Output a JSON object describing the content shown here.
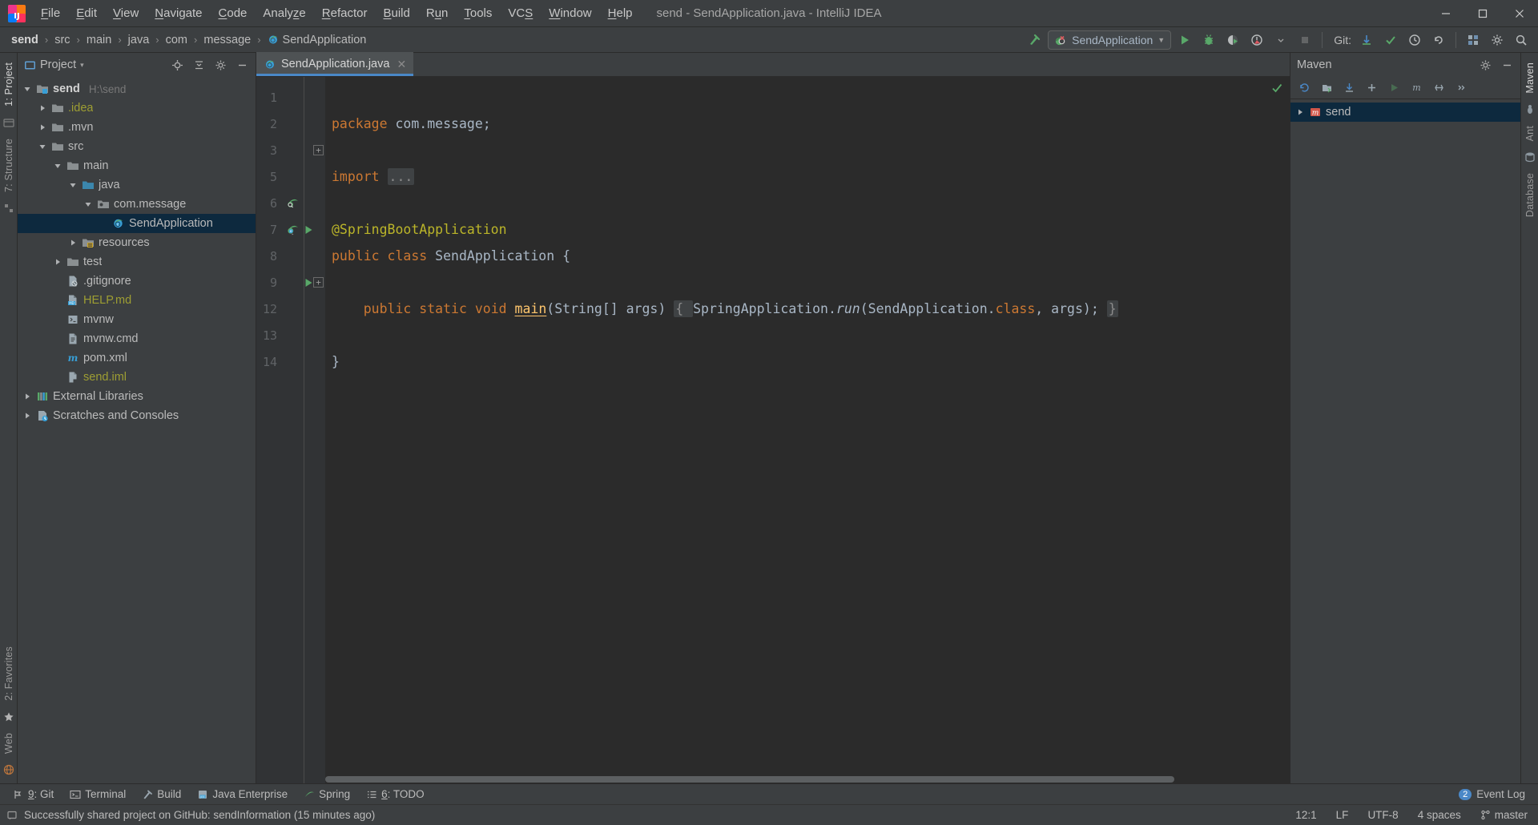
{
  "window": {
    "title": "send - SendApplication.java - IntelliJ IDEA",
    "minimize": "─",
    "maximize": "❐",
    "close": "✕"
  },
  "menubar": {
    "items": [
      {
        "label": "File",
        "mnemonic": "F"
      },
      {
        "label": "Edit",
        "mnemonic": "E"
      },
      {
        "label": "View",
        "mnemonic": "V"
      },
      {
        "label": "Navigate",
        "mnemonic": "N"
      },
      {
        "label": "Code",
        "mnemonic": "C"
      },
      {
        "label": "Analyze",
        "mnemonic": "z"
      },
      {
        "label": "Refactor",
        "mnemonic": "R"
      },
      {
        "label": "Build",
        "mnemonic": "B"
      },
      {
        "label": "Run",
        "mnemonic": "u"
      },
      {
        "label": "Tools",
        "mnemonic": "T"
      },
      {
        "label": "VCS",
        "mnemonic": "S"
      },
      {
        "label": "Window",
        "mnemonic": "W"
      },
      {
        "label": "Help",
        "mnemonic": "H"
      }
    ]
  },
  "navbar": {
    "breadcrumbs": [
      "send",
      "src",
      "main",
      "java",
      "com",
      "message",
      "SendApplication"
    ],
    "separator": "›",
    "run_config": {
      "name": "SendApplication",
      "dropdown_arrow": "▼"
    },
    "actions": [
      {
        "name": "build-hammer-icon",
        "tooltip": "Build"
      },
      {
        "name": "run-icon",
        "tooltip": "Run"
      },
      {
        "name": "debug-icon",
        "tooltip": "Debug"
      },
      {
        "name": "run-coverage-icon",
        "tooltip": "Run with Coverage"
      },
      {
        "name": "profile-icon",
        "tooltip": "Profile"
      },
      {
        "name": "stop-icon",
        "tooltip": "Stop"
      }
    ],
    "git_label": "Git:",
    "git_actions": [
      {
        "name": "update-project-icon",
        "tooltip": "Update Project"
      },
      {
        "name": "commit-icon",
        "tooltip": "Commit"
      },
      {
        "name": "history-icon",
        "tooltip": "Show History"
      },
      {
        "name": "rollback-icon",
        "tooltip": "Rollback"
      }
    ],
    "right_actions": [
      {
        "name": "search-everywhere-icon",
        "tooltip": "Search Everywhere"
      },
      {
        "name": "settings-icon",
        "tooltip": "Settings"
      },
      {
        "name": "project-structure-icon",
        "tooltip": "Project Structure"
      }
    ]
  },
  "left_strip": {
    "tabs": [
      {
        "label": "1: Project",
        "active": true
      },
      {
        "label": "7: Structure",
        "active": false
      },
      {
        "label": "2: Favorites",
        "active": false
      },
      {
        "label": "Web",
        "active": false
      }
    ]
  },
  "right_strip": {
    "tabs": [
      {
        "label": "Maven",
        "active": true
      },
      {
        "label": "Ant",
        "active": false
      },
      {
        "label": "Database",
        "active": false
      }
    ]
  },
  "project_panel": {
    "title": "Project",
    "dropdown_arrow": "▾",
    "actions": [
      {
        "name": "locate-icon",
        "tooltip": "Select Opened File"
      },
      {
        "name": "collapse-all-icon",
        "tooltip": "Collapse All"
      },
      {
        "name": "gear-icon",
        "tooltip": "Options"
      },
      {
        "name": "hide-icon",
        "tooltip": "Hide"
      }
    ],
    "tree": [
      {
        "label": "send",
        "path": "H:\\send",
        "indent": 0,
        "twisty": "open",
        "icon": "module-folder-icon",
        "bold": true,
        "selected": false,
        "olive": false
      },
      {
        "label": ".idea",
        "path": "",
        "indent": 1,
        "twisty": "closed",
        "icon": "folder-icon",
        "bold": false,
        "selected": false,
        "olive": true
      },
      {
        "label": ".mvn",
        "path": "",
        "indent": 1,
        "twisty": "closed",
        "icon": "folder-icon",
        "bold": false,
        "selected": false,
        "olive": false
      },
      {
        "label": "src",
        "path": "",
        "indent": 1,
        "twisty": "open",
        "icon": "folder-icon",
        "bold": false,
        "selected": false,
        "olive": false
      },
      {
        "label": "main",
        "path": "",
        "indent": 2,
        "twisty": "open",
        "icon": "folder-icon",
        "bold": false,
        "selected": false,
        "olive": false
      },
      {
        "label": "java",
        "path": "",
        "indent": 3,
        "twisty": "open",
        "icon": "source-folder-icon",
        "bold": false,
        "selected": false,
        "olive": false
      },
      {
        "label": "com.message",
        "path": "",
        "indent": 4,
        "twisty": "open",
        "icon": "package-icon",
        "bold": false,
        "selected": false,
        "olive": false
      },
      {
        "label": "SendApplication",
        "path": "",
        "indent": 5,
        "twisty": "none",
        "icon": "spring-class-icon",
        "bold": false,
        "selected": true,
        "olive": false
      },
      {
        "label": "resources",
        "path": "",
        "indent": 3,
        "twisty": "closed",
        "icon": "resource-folder-icon",
        "bold": false,
        "selected": false,
        "olive": false
      },
      {
        "label": "test",
        "path": "",
        "indent": 2,
        "twisty": "closed",
        "icon": "folder-icon",
        "bold": false,
        "selected": false,
        "olive": false
      },
      {
        "label": ".gitignore",
        "path": "",
        "indent": 2,
        "twisty": "none",
        "icon": "gitignore-file-icon",
        "bold": false,
        "selected": false,
        "olive": false
      },
      {
        "label": "HELP.md",
        "path": "",
        "indent": 2,
        "twisty": "none",
        "icon": "markdown-file-icon",
        "bold": false,
        "selected": false,
        "olive": true
      },
      {
        "label": "mvnw",
        "path": "",
        "indent": 2,
        "twisty": "none",
        "icon": "script-file-icon",
        "bold": false,
        "selected": false,
        "olive": false
      },
      {
        "label": "mvnw.cmd",
        "path": "",
        "indent": 2,
        "twisty": "none",
        "icon": "text-file-icon",
        "bold": false,
        "selected": false,
        "olive": false
      },
      {
        "label": "pom.xml",
        "path": "",
        "indent": 2,
        "twisty": "none",
        "icon": "maven-file-icon",
        "bold": false,
        "selected": false,
        "olive": false
      },
      {
        "label": "send.iml",
        "path": "",
        "indent": 2,
        "twisty": "none",
        "icon": "iml-file-icon",
        "bold": false,
        "selected": false,
        "olive": true
      },
      {
        "label": "External Libraries",
        "path": "",
        "indent": 0,
        "twisty": "closed",
        "icon": "libraries-icon",
        "bold": false,
        "selected": false,
        "olive": false
      },
      {
        "label": "Scratches and Consoles",
        "path": "",
        "indent": 0,
        "twisty": "closed",
        "icon": "scratches-icon",
        "bold": false,
        "selected": false,
        "olive": false
      }
    ]
  },
  "editor": {
    "tab": {
      "label": "SendApplication.java",
      "close": "✕",
      "icon": "spring-class-icon"
    },
    "gutter_lines": [
      {
        "num": "1",
        "mark": "",
        "mark2": "",
        "fold": ""
      },
      {
        "num": "2",
        "mark": "",
        "mark2": "",
        "fold": ""
      },
      {
        "num": "3",
        "mark": "",
        "mark2": "",
        "fold": "+"
      },
      {
        "num": "5",
        "mark": "",
        "mark2": "",
        "fold": ""
      },
      {
        "num": "6",
        "mark": "spring-bean-icon",
        "mark2": "",
        "fold": ""
      },
      {
        "num": "7",
        "mark": "spring-boot-icon",
        "mark2": "run-gutter-icon",
        "fold": ""
      },
      {
        "num": "8",
        "mark": "",
        "mark2": "",
        "fold": ""
      },
      {
        "num": "9",
        "mark": "",
        "mark2": "run-gutter-icon",
        "fold": "+"
      },
      {
        "num": "12",
        "mark": "",
        "mark2": "",
        "fold": ""
      },
      {
        "num": "13",
        "mark": "",
        "mark2": "",
        "fold": ""
      },
      {
        "num": "14",
        "mark": "",
        "mark2": "",
        "fold": ""
      }
    ],
    "code": {
      "l1_kw": "package",
      "l1_rest": " com.message;",
      "l3_kw": "import",
      "l3_fold": "...",
      "l6_ann": "@SpringBootApplication",
      "l7_kw1": "public",
      "l7_kw2": "class",
      "l7_name": " SendApplication ",
      "l7_brace": "{",
      "l9_kw1": "public",
      "l9_kw2": "static",
      "l9_kw3": "void",
      "l9_name": "main",
      "l9_params": "(String[] args) ",
      "l9_fold_open": "{ ",
      "l9_body_a": "SpringApplication.",
      "l9_body_run": "run",
      "l9_body_b": "(SendApplication.",
      "l9_body_class": "class",
      "l9_body_c": ", args); ",
      "l9_fold_close": "}",
      "l13_brace": "}"
    },
    "inspection_status": "ok",
    "scroll_thumb_pct": 88
  },
  "maven_panel": {
    "title": "Maven",
    "actions": [
      {
        "name": "reimport-icon",
        "tooltip": "Reimport All Maven Projects"
      },
      {
        "name": "generate-sources-icon",
        "tooltip": "Generate Sources"
      },
      {
        "name": "download-sources-icon",
        "tooltip": "Download Sources"
      },
      {
        "name": "add-maven-project-icon",
        "tooltip": "Add Maven Projects"
      },
      {
        "name": "run-maven-build-icon",
        "tooltip": "Run Maven Build"
      },
      {
        "name": "toggle-offline-icon",
        "tooltip": "Toggle Offline Mode"
      },
      {
        "name": "skip-tests-icon",
        "tooltip": "Toggle Skip Tests Mode"
      },
      {
        "name": "more-icon",
        "tooltip": "More"
      }
    ],
    "settings_icon": "gear-icon",
    "hide_icon": "hide-icon",
    "tree": [
      {
        "label": "send",
        "twisty": "closed",
        "icon": "maven-project-icon",
        "selected": true
      }
    ]
  },
  "bottom_bar": {
    "windows": [
      {
        "label": "9: Git",
        "mnemonic": "9",
        "icon": "git-icon"
      },
      {
        "label": "Terminal",
        "mnemonic": "",
        "icon": "terminal-icon"
      },
      {
        "label": "Build",
        "mnemonic": "",
        "icon": "build-hammer-icon"
      },
      {
        "label": "Java Enterprise",
        "mnemonic": "",
        "icon": "java-enterprise-icon"
      },
      {
        "label": "Spring",
        "mnemonic": "",
        "icon": "spring-leaf-icon"
      },
      {
        "label": "6: TODO",
        "mnemonic": "6",
        "icon": "todo-icon"
      }
    ],
    "event_log": {
      "label": "Event Log",
      "count": "2"
    }
  },
  "statusbar": {
    "message": "Successfully shared project on GitHub: sendInformation (15 minutes ago)",
    "message_icon": "balloon-icon",
    "caret_position": "12:1",
    "line_separator": "LF",
    "encoding": "UTF-8",
    "indent": "4 spaces",
    "branch": "master",
    "branch_icon": "git-branch-icon"
  },
  "colors": {
    "bg_panel": "#3c3f41",
    "bg_editor": "#2b2b2b",
    "bg_gutter": "#313335",
    "accent_blue": "#4a88c7",
    "selection": "#0d293e",
    "keyword_orange": "#cc7832",
    "annotation_yellow": "#bbb529",
    "declaration_yellow": "#ffc66d",
    "text_default": "#a9b7c6",
    "olive_vcs": "#9e9e33",
    "green_run": "#59a869"
  }
}
